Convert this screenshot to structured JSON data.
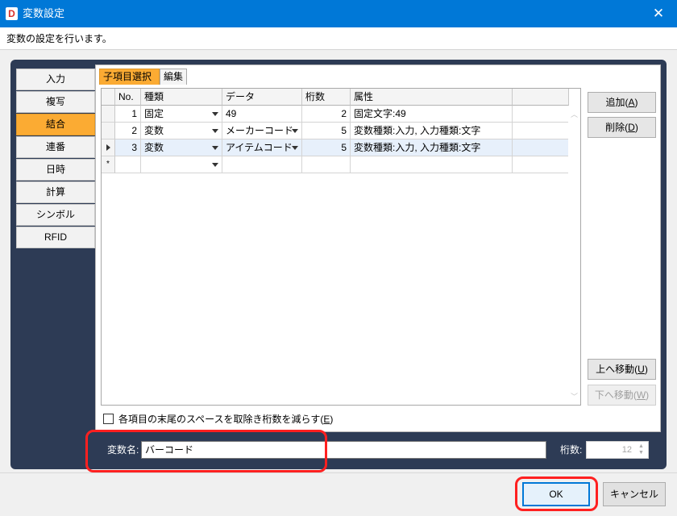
{
  "window": {
    "icon_letter": "D",
    "title": "変数設定"
  },
  "description": "変数の設定を行います。",
  "categories": [
    "入力",
    "複写",
    "結合",
    "連番",
    "日時",
    "計算",
    "シンボル",
    "RFID"
  ],
  "active_category": "結合",
  "subtabs": [
    "子項目選択",
    "編集"
  ],
  "grid": {
    "headers": [
      "No.",
      "種類",
      "データ",
      "桁数",
      "属性"
    ],
    "rows": [
      {
        "no": "1",
        "type": "固定",
        "data": "49",
        "digits": "2",
        "attr": "固定文字:49"
      },
      {
        "no": "2",
        "type": "変数",
        "data": "メーカーコード",
        "digits": "5",
        "attr": "変数種類:入力, 入力種類:文字"
      },
      {
        "no": "3",
        "type": "変数",
        "data": "アイテムコード",
        "digits": "5",
        "attr": "変数種類:入力, 入力種類:文字"
      }
    ],
    "new_row_marker": "*"
  },
  "buttons": {
    "add": {
      "label": "追加(",
      "key": "A",
      "suffix": ")"
    },
    "delete": {
      "label": "削除(",
      "key": "D",
      "suffix": ")"
    },
    "move_up": {
      "label": "上へ移動(",
      "key": "U",
      "suffix": ")"
    },
    "move_down": {
      "label": "下へ移動(",
      "key": "W",
      "suffix": ")"
    }
  },
  "checkbox": {
    "label": "各項目の末尾のスペースを取除き桁数を減らす(",
    "key": "E",
    "suffix": ")"
  },
  "variable_name": {
    "label": "変数名:",
    "value": "バーコード"
  },
  "digits": {
    "label": "桁数:",
    "value": "12"
  },
  "footer": {
    "ok": "OK",
    "cancel": "キャンセル"
  },
  "colors": {
    "accent": "#0078d7",
    "active_tab": "#fbab33",
    "panel": "#2d3b55",
    "highlight": "#ff2020"
  }
}
